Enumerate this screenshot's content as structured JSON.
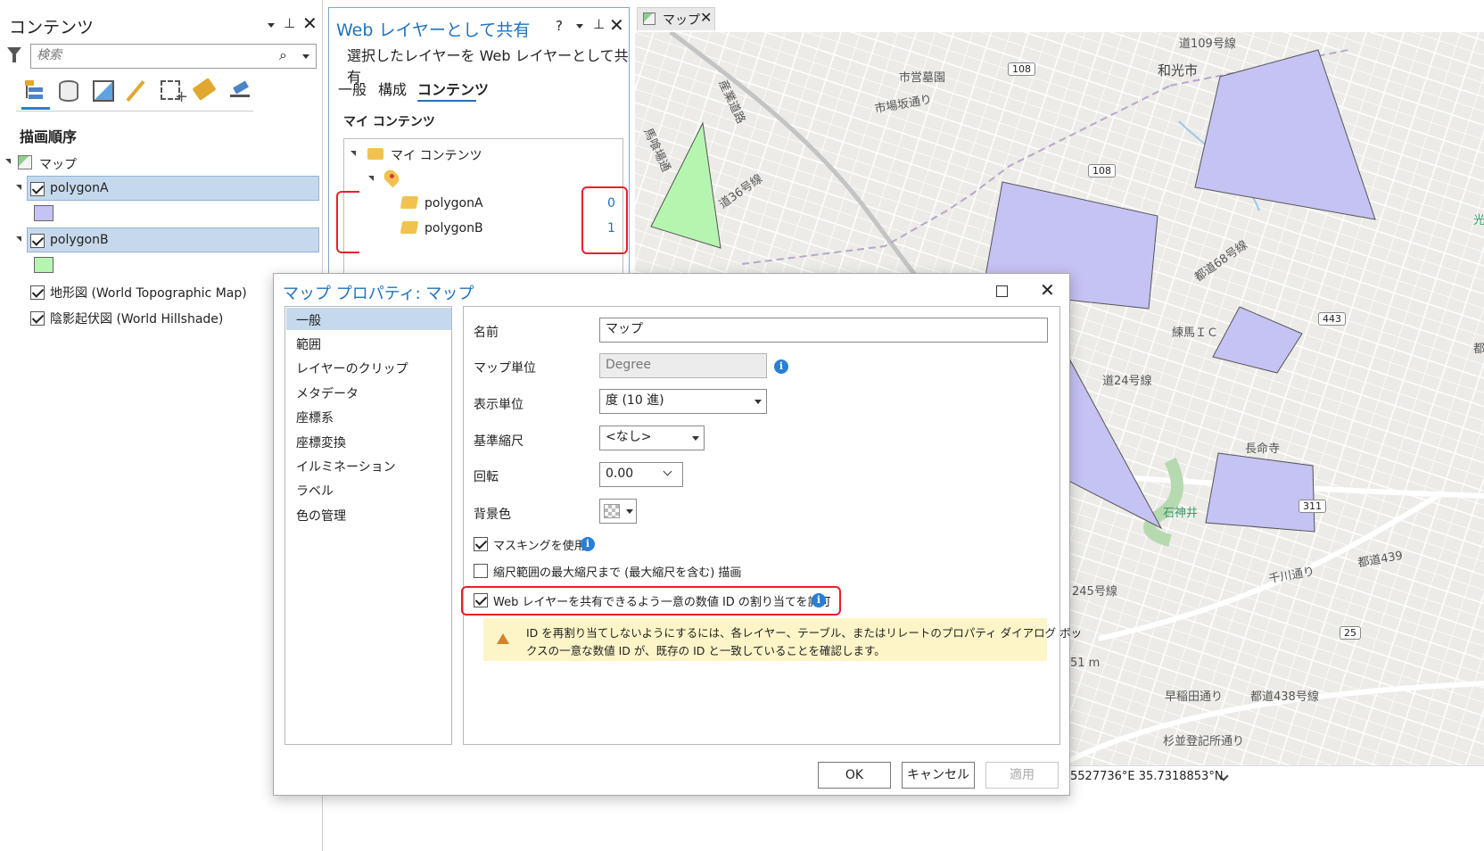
{
  "contents_pane": {
    "title": "コンテンツ",
    "search_placeholder": "検索",
    "section": "描画順序",
    "map_item": "マップ",
    "layers": [
      {
        "name": "polygonA",
        "checked": true,
        "swatch": "#c5c2f4"
      },
      {
        "name": "polygonB",
        "checked": true,
        "swatch": "#b6f5b0"
      }
    ],
    "basemaps": [
      {
        "name": "地形図 (World Topographic Map)",
        "checked": true
      },
      {
        "name": "陰影起伏図 (World Hillshade)",
        "checked": true
      }
    ],
    "toolbar_icons": [
      "list-by-drawing-order-icon",
      "list-by-data-source-icon",
      "list-by-selection-icon",
      "list-by-editing-icon",
      "list-by-snapping-icon",
      "list-by-labeling-icon",
      "list-by-perspective-icon"
    ]
  },
  "share_pane": {
    "title": "Web レイヤーとして共有",
    "help": "?",
    "subtitle": "選択したレイヤーを Web レイヤーとして共有",
    "tabs": [
      "一般",
      "構成",
      "コンテンツ"
    ],
    "active_tab": "コンテンツ",
    "section": "マイ コンテンツ",
    "tree_root": "マイ コンテンツ",
    "items": [
      {
        "name": "polygonA",
        "id": "0"
      },
      {
        "name": "polygonB",
        "id": "1"
      }
    ]
  },
  "map_view": {
    "tab_label": "マップ",
    "coordinates": "5527736°E 35.7318853°N",
    "labels": [
      "和光市",
      "市営墓園",
      "市場坂通り",
      "産業道路",
      "馬喰場通",
      "道36号線",
      "都道68号線",
      "練馬ＩＣ",
      "道24号線",
      "長命寺",
      "石神井",
      "245号線",
      "千川通り",
      "都道439",
      "早稲田通り",
      "都道438号線",
      "杉並登記所通り",
      "51 m",
      "道109号線",
      "光",
      "都"
    ],
    "road_shields": [
      "108",
      "108",
      "443",
      "311",
      "25"
    ],
    "colors": {
      "polygon_purple": "#c5c2f4",
      "polygon_green": "#b6f5b0"
    }
  },
  "dialog": {
    "title": "マップ プロパティ: マップ",
    "nav": [
      "一般",
      "範囲",
      "レイヤーのクリップ",
      "メタデータ",
      "座標系",
      "座標変換",
      "イルミネーション",
      "ラベル",
      "色の管理"
    ],
    "active_nav": "一般",
    "name_label": "名前",
    "name_value": "マップ",
    "map_units_label": "マップ単位",
    "map_units_value": "Degree",
    "display_units_label": "表示単位",
    "display_units_value": "度 (10 進)",
    "reference_scale_label": "基準縮尺",
    "reference_scale_value": "<なし>",
    "rotation_label": "回転",
    "rotation_value": "0.00",
    "background_label": "背景色",
    "masking_label": "マスキングを使用",
    "masking_checked": true,
    "draw_scale_label": "縮尺範囲の最大縮尺まで (最大縮尺を含む) 描画",
    "draw_scale_checked": false,
    "allow_ids_label": "Web レイヤーを共有できるよう一意の数値 ID の割り当てを許可",
    "allow_ids_checked": true,
    "warning_line1": "ID を再割り当てしないようにするには、各レイヤー、テーブル、またはリレートのプロパティ ダイアログ ボッ",
    "warning_line2": "クスの一意な数値 ID が、既存の ID と一致していることを確認します。",
    "ok_label": "OK",
    "cancel_label": "キャンセル",
    "apply_label": "適用",
    "accent": "#1e73be",
    "highlight": "#e8202a"
  }
}
